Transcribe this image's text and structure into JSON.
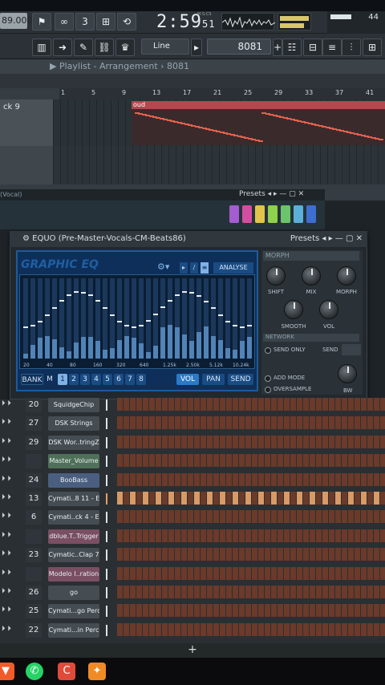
{
  "transport": {
    "tempo": "89.000",
    "time_main": "2:59",
    "time_sub": "51",
    "msc_label": "M:S:CS",
    "snap": "Line",
    "pattern": "8081",
    "vu_value": "44"
  },
  "playlist": {
    "title": "Playlist - Arrangement",
    "pattern": "8081",
    "track_label": "ck 9",
    "clip_name": "oud",
    "ruler": [
      "1",
      "5",
      "9",
      "13",
      "17",
      "21",
      "25",
      "29",
      "33",
      "37",
      "41"
    ]
  },
  "mixer": {
    "title": "Vocal",
    "presets": "Presets"
  },
  "equo": {
    "title": "EQUO (Pre-Master-Vocals-CM-Beats86)",
    "presets": "Presets",
    "graphic_title": "GRAPHIC EQ",
    "analyse": "ANALYSE",
    "freq_labels": [
      "20",
      "40",
      "80",
      "160",
      "320",
      "640",
      "1.25k",
      "2.50k",
      "5.12k",
      "10.24k"
    ],
    "bank": "BANK",
    "m": "M",
    "bands": [
      "1",
      "2",
      "3",
      "4",
      "5",
      "6",
      "7",
      "8"
    ],
    "modes": [
      "VOL",
      "PAN",
      "SEND"
    ],
    "morph_label": "MORPH",
    "knobs": {
      "shift": "SHIFT",
      "mix": "MIX",
      "morph": "MORPH",
      "smooth": "SMOOTH",
      "vol": "VOL"
    },
    "send_section": "NETWORK",
    "send_only": "SEND ONLY",
    "send": "SEND",
    "add_mode": "ADD MODE",
    "oversample": "OVERSAMPLE",
    "bw": "BW"
  },
  "rack": {
    "rows": [
      {
        "num": "20",
        "name": "SquidgeChip",
        "style": "gray"
      },
      {
        "num": "27",
        "name": "DSK Strings",
        "style": "gray"
      },
      {
        "num": "29",
        "name": "DSK Wor..tringZ",
        "style": "gray"
      },
      {
        "num": "",
        "name": "Master_Volume",
        "style": "green"
      },
      {
        "num": "24",
        "name": "BooBass",
        "style": "blue"
      },
      {
        "num": "13",
        "name": "Cymati..8 11 - E",
        "style": "gray"
      },
      {
        "num": "6",
        "name": "Cymati..ck 4 - E",
        "style": "gray"
      },
      {
        "num": "",
        "name": "dblue.T..Trigger",
        "style": "pink"
      },
      {
        "num": "23",
        "name": "Cymatic..Clap 7",
        "style": "gray"
      },
      {
        "num": "",
        "name": "Modelo I..ration",
        "style": "pink"
      },
      {
        "num": "26",
        "name": "go",
        "style": "gray"
      },
      {
        "num": "25",
        "name": "Cymati...go Perc",
        "style": "gray"
      },
      {
        "num": "22",
        "name": "Cymati...in Perc",
        "style": "gray"
      }
    ],
    "add_label": "+"
  },
  "taskbar": {
    "apps": [
      "brave-icon",
      "whatsapp-icon",
      "app-icon",
      "fl-studio-icon"
    ]
  }
}
